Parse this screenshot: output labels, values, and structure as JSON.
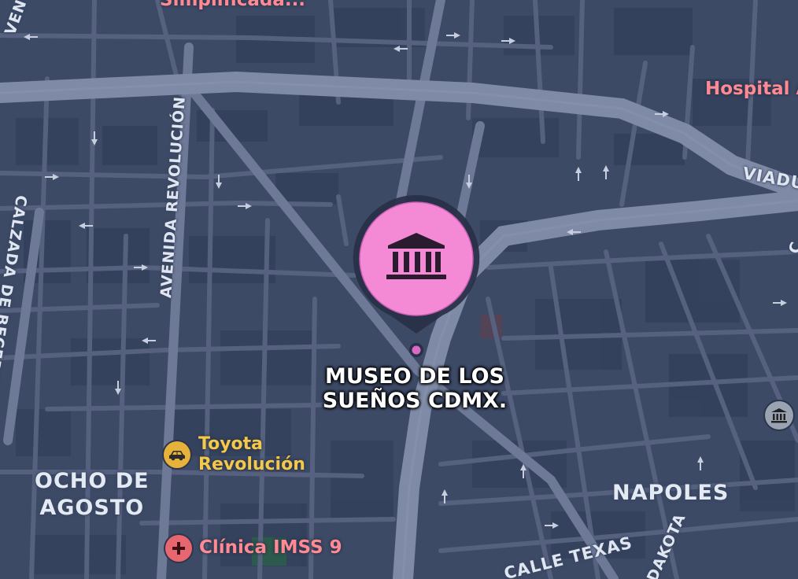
{
  "labels": {
    "top_partial": "Simplificada...",
    "hospital": "Hospital A",
    "viaduct": "VIADU",
    "avenida_revolucion": "AVENIDA REVOLUCIÓN",
    "calzada_becerra": "CALZADA DE BECERRA",
    "ocho_de_agosto_1": "OCHO DE",
    "ocho_de_agosto_2": "AGOSTO",
    "napoles": "NAPOLES",
    "calle_texas": "CALLE TEXAS",
    "dakota": "DAKOTA",
    "left_partial": "VEN",
    "right_partial": "C"
  },
  "pois": {
    "museum": {
      "line1": "MUSEO DE LOS",
      "line2": "SUEÑOS CDMX.",
      "icon": "museum-building-icon",
      "color": "#f48ad6"
    },
    "toyota": {
      "line1": "Toyota",
      "line2": "Revolución",
      "icon": "car-icon",
      "color": "#e6b23a"
    },
    "clinica": {
      "label": "Clínica IMSS 9",
      "icon": "medical-cross-icon",
      "color": "#e8666f"
    },
    "right_museum": {
      "icon": "museum-building-icon",
      "color": "#9aa3b2"
    }
  },
  "colors": {
    "land": "#3d4a66",
    "minor_road": "#56627f",
    "major_road": "#6c7894",
    "highway": "#7d89a4",
    "building": "#33405a",
    "park": "#2c5a4c"
  }
}
